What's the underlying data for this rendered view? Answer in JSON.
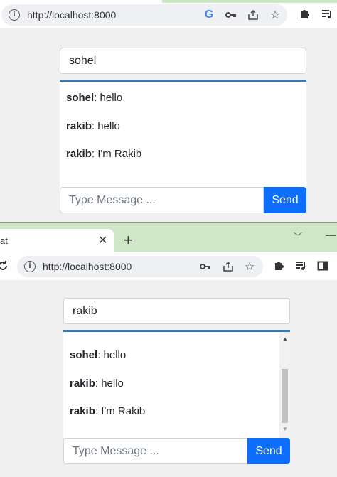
{
  "window1": {
    "url": "http://localhost:8000",
    "username": "sohel",
    "messages": [
      {
        "user": "sohel",
        "text": ": hello"
      },
      {
        "user": "rakib",
        "text": ": hello"
      },
      {
        "user": "rakib",
        "text": ": I'm Rakib"
      }
    ],
    "message_placeholder": "Type Message ...",
    "send_label": "Send"
  },
  "window2": {
    "tab_title": "at",
    "url": "http://localhost:8000",
    "username": "rakib",
    "messages": [
      {
        "user": "sohel",
        "text": ": hello"
      },
      {
        "user": "rakib",
        "text": ": hello"
      },
      {
        "user": "rakib",
        "text": ": I'm Rakib"
      }
    ],
    "message_placeholder": "Type Message ...",
    "send_label": "Send"
  },
  "icons": {
    "info": "info-icon",
    "google": "google-icon",
    "key": "key-icon",
    "share": "share-icon",
    "star": "star-icon",
    "extensions": "puzzle-icon",
    "media": "media-control-icon",
    "sidepanel": "side-panel-icon",
    "reload": "reload-icon"
  },
  "colors": {
    "accent": "#0d6efd",
    "chat_border": "#337ab7",
    "tabstrip": "#cfe7c7"
  }
}
